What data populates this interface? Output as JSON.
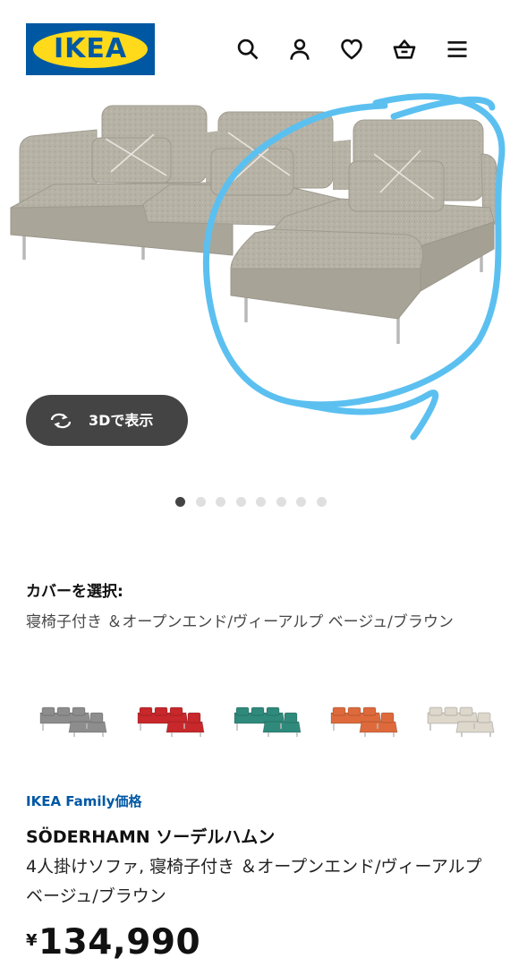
{
  "header": {
    "logo_text": "IKEA",
    "icons": [
      "search-icon",
      "account-icon",
      "heart-icon",
      "basket-icon",
      "menu-icon"
    ]
  },
  "hero": {
    "view_3d_label": "3Dで表示",
    "carousel_count": 8,
    "carousel_active": 1
  },
  "cover": {
    "label": "カバーを選択:",
    "value": "寝椅子付き ＆オープンエンド/ヴィーアルプ ベージュ/ブラウン",
    "swatch_colors": [
      "#8d8d8d",
      "#c8282b",
      "#2f8a7c",
      "#de6a3c",
      "#ddd7cc"
    ]
  },
  "product": {
    "family_label": "IKEA Family価格",
    "name": "SÖDERHAMN ソーデルハムン",
    "description": "4人掛けソファ, 寝椅子付き ＆オープンエンド/ヴィーアルプ ベージュ/ブラウン",
    "currency": "¥",
    "price": "134,990"
  },
  "colors": {
    "ikea_blue": "#0058a3",
    "ikea_yellow": "#ffda1a",
    "sofa": "#b4b0a4",
    "annotation_circle": "#5bc0f0"
  }
}
